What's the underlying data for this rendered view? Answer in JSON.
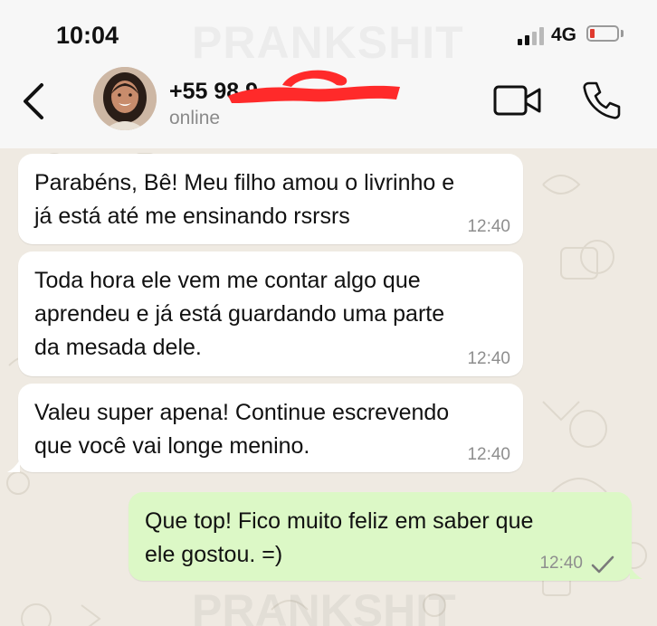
{
  "status_bar": {
    "time": "10:04",
    "network": "4G",
    "watermark": "PRANKSHIT"
  },
  "header": {
    "contact_name": "+55 98 9",
    "contact_status": "online",
    "back_icon": "chevron-left-icon",
    "video_icon": "video-camera-icon",
    "call_icon": "phone-icon"
  },
  "messages": [
    {
      "direction": "incoming",
      "text": "Parabéns, Bê! Meu filho amou o livrinho e\njá está até me ensinando rsrsrs",
      "time": "12:40"
    },
    {
      "direction": "incoming",
      "text": "Toda hora ele vem me contar algo que\naprendeu e já está guardando uma parte\nda mesada dele.",
      "time": "12:40"
    },
    {
      "direction": "incoming",
      "text": "Valeu super apena! Continue escrevendo\nque você vai longe menino.",
      "time": "12:40"
    },
    {
      "direction": "outgoing",
      "text": "Que top! Fico muito feliz em saber que\nele gostou. =)",
      "time": "12:40",
      "status": "sent"
    }
  ],
  "footer": {
    "watermark": "PRANKSHIT"
  },
  "colors": {
    "incoming_bubble": "#ffffff",
    "outgoing_bubble": "#dcf8c6",
    "chat_background": "#efeae2",
    "redaction": "#ff2a2a"
  }
}
